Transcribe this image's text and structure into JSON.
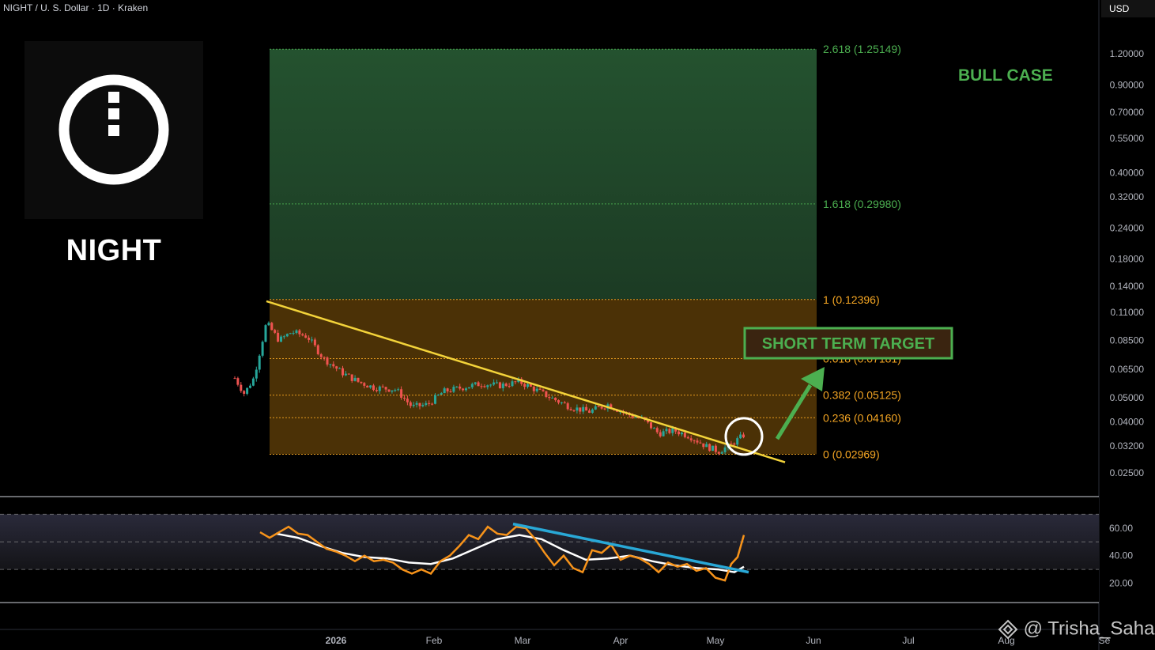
{
  "header": {
    "symbol_line": "NIGHT / U. S. Dollar · 1D · Kraken"
  },
  "logo": {
    "icon": "night-logo-icon",
    "name": "NIGHT"
  },
  "currency": "USD",
  "watermark": "@ Trisha_Saha",
  "colors": {
    "background": "#000000",
    "bull_zone": "#1f4a2c",
    "base_zone": "#5a3a08",
    "fib_green": "#4caf50",
    "fib_orange": "#f5a623",
    "trendline": "#f3d33a",
    "rsi_line": "#f7931a",
    "rsi_ma": "#ffffff",
    "rsi_trend": "#29a8d6",
    "candle_up": "#26a69a",
    "candle_down": "#ef5350"
  },
  "chart_data": {
    "type": "candlestick",
    "scale": "log",
    "y_ticks": [
      1.2,
      0.9,
      0.7,
      0.55,
      0.4,
      0.32,
      0.24,
      0.18,
      0.14,
      0.11,
      0.085,
      0.065,
      0.05,
      0.04,
      0.032,
      0.025
    ],
    "y_tick_labels": [
      "1.20000",
      "0.90000",
      "0.70000",
      "0.55000",
      "0.40000",
      "0.32000",
      "0.24000",
      "0.18000",
      "0.14000",
      "0.11000",
      "0.08500",
      "0.06500",
      "0.05000",
      "0.04000",
      "0.03200",
      "0.02500"
    ],
    "x_ticks": [
      {
        "date": "2026-01-01",
        "label": "2026"
      },
      {
        "date": "2026-02-01",
        "label": "Feb"
      },
      {
        "date": "2026-03-01",
        "label": "Mar"
      },
      {
        "date": "2026-04-01",
        "label": "Apr"
      },
      {
        "date": "2026-05-01",
        "label": "May"
      },
      {
        "date": "2026-06-01",
        "label": "Jun"
      },
      {
        "date": "2026-07-01",
        "label": "Jul"
      },
      {
        "date": "2026-08-01",
        "label": "Aug"
      },
      {
        "date": "2026-09-01",
        "label": "Se"
      }
    ],
    "fib_levels": [
      {
        "ratio": "2.618",
        "value": 1.25149,
        "label": "2.618 (1.25149)",
        "zone": "bull"
      },
      {
        "ratio": "1.618",
        "value": 0.2998,
        "label": "1.618 (0.29980)",
        "zone": "bull"
      },
      {
        "ratio": "1",
        "value": 0.12396,
        "label": "1 (0.12396)",
        "zone": "base"
      },
      {
        "ratio": "0.618",
        "value": 0.07181,
        "label": "0.618 (0.07181)",
        "zone": "base"
      },
      {
        "ratio": "0.382",
        "value": 0.05125,
        "label": "0.382 (0.05125)",
        "zone": "base"
      },
      {
        "ratio": "0.236",
        "value": 0.0416,
        "label": "0.236 (0.04160)",
        "zone": "base"
      },
      {
        "ratio": "0",
        "value": 0.02969,
        "label": "0 (0.02969)",
        "zone": "base"
      }
    ],
    "fib_range": {
      "start": "2025-12-13",
      "end": "2026-06-04"
    },
    "annotations": {
      "bull_case": "BULL CASE",
      "short_term_target": "SHORT TERM TARGET"
    },
    "trendline": [
      {
        "date": "2025-12-12",
        "value": 0.122
      },
      {
        "date": "2026-05-15",
        "value": 0.0302
      }
    ],
    "breakout_circle": {
      "date": "2026-05-11",
      "value": 0.035
    },
    "price_path": [
      {
        "date": "2025-12-02",
        "value": 0.06
      },
      {
        "date": "2025-12-05",
        "value": 0.052
      },
      {
        "date": "2025-12-08",
        "value": 0.06
      },
      {
        "date": "2025-12-12",
        "value": 0.1
      },
      {
        "date": "2025-12-16",
        "value": 0.085
      },
      {
        "date": "2025-12-20",
        "value": 0.092
      },
      {
        "date": "2025-12-25",
        "value": 0.088
      },
      {
        "date": "2025-12-30",
        "value": 0.072
      },
      {
        "date": "2026-01-05",
        "value": 0.063
      },
      {
        "date": "2026-01-10",
        "value": 0.058
      },
      {
        "date": "2026-01-15",
        "value": 0.055
      },
      {
        "date": "2026-01-22",
        "value": 0.054
      },
      {
        "date": "2026-01-27",
        "value": 0.046
      },
      {
        "date": "2026-02-01",
        "value": 0.047
      },
      {
        "date": "2026-02-06",
        "value": 0.053
      },
      {
        "date": "2026-02-12",
        "value": 0.055
      },
      {
        "date": "2026-02-18",
        "value": 0.057
      },
      {
        "date": "2026-02-24",
        "value": 0.056
      },
      {
        "date": "2026-03-02",
        "value": 0.058
      },
      {
        "date": "2026-03-07",
        "value": 0.054
      },
      {
        "date": "2026-03-12",
        "value": 0.05
      },
      {
        "date": "2026-03-18",
        "value": 0.046
      },
      {
        "date": "2026-03-24",
        "value": 0.044
      },
      {
        "date": "2026-03-30",
        "value": 0.047
      },
      {
        "date": "2026-04-05",
        "value": 0.043
      },
      {
        "date": "2026-04-10",
        "value": 0.041
      },
      {
        "date": "2026-04-15",
        "value": 0.036
      },
      {
        "date": "2026-04-20",
        "value": 0.037
      },
      {
        "date": "2026-04-25",
        "value": 0.035
      },
      {
        "date": "2026-04-30",
        "value": 0.032
      },
      {
        "date": "2026-05-04",
        "value": 0.0305
      },
      {
        "date": "2026-05-08",
        "value": 0.0325
      },
      {
        "date": "2026-05-12",
        "value": 0.0355
      }
    ],
    "rsi": {
      "y_ticks": [
        60,
        40,
        20
      ],
      "y_tick_labels": [
        "60.00",
        "40.00",
        "20.00"
      ],
      "bands": [
        70,
        50,
        30
      ],
      "ylim": [
        10,
        80
      ],
      "rsi_values": [
        {
          "date": "2025-12-10",
          "value": 57
        },
        {
          "date": "2025-12-13",
          "value": 53
        },
        {
          "date": "2025-12-16",
          "value": 57
        },
        {
          "date": "2025-12-19",
          "value": 61
        },
        {
          "date": "2025-12-22",
          "value": 56
        },
        {
          "date": "2025-12-25",
          "value": 55
        },
        {
          "date": "2025-12-28",
          "value": 50
        },
        {
          "date": "2025-12-31",
          "value": 45
        },
        {
          "date": "2026-01-03",
          "value": 43
        },
        {
          "date": "2026-01-06",
          "value": 40
        },
        {
          "date": "2026-01-09",
          "value": 36
        },
        {
          "date": "2026-01-12",
          "value": 40
        },
        {
          "date": "2026-01-15",
          "value": 36
        },
        {
          "date": "2026-01-18",
          "value": 37
        },
        {
          "date": "2026-01-21",
          "value": 35
        },
        {
          "date": "2026-01-24",
          "value": 30
        },
        {
          "date": "2026-01-27",
          "value": 27
        },
        {
          "date": "2026-01-30",
          "value": 30
        },
        {
          "date": "2026-02-02",
          "value": 27
        },
        {
          "date": "2026-02-05",
          "value": 36
        },
        {
          "date": "2026-02-08",
          "value": 40
        },
        {
          "date": "2026-02-11",
          "value": 47
        },
        {
          "date": "2026-02-14",
          "value": 55
        },
        {
          "date": "2026-02-17",
          "value": 52
        },
        {
          "date": "2026-02-20",
          "value": 61
        },
        {
          "date": "2026-02-23",
          "value": 56
        },
        {
          "date": "2026-02-26",
          "value": 55
        },
        {
          "date": "2026-03-01",
          "value": 61
        },
        {
          "date": "2026-03-04",
          "value": 60
        },
        {
          "date": "2026-03-07",
          "value": 52
        },
        {
          "date": "2026-03-10",
          "value": 42
        },
        {
          "date": "2026-03-13",
          "value": 33
        },
        {
          "date": "2026-03-16",
          "value": 40
        },
        {
          "date": "2026-03-19",
          "value": 31
        },
        {
          "date": "2026-03-22",
          "value": 28
        },
        {
          "date": "2026-03-25",
          "value": 44
        },
        {
          "date": "2026-03-28",
          "value": 42
        },
        {
          "date": "2026-03-31",
          "value": 48
        },
        {
          "date": "2026-04-03",
          "value": 37
        },
        {
          "date": "2026-04-06",
          "value": 40
        },
        {
          "date": "2026-04-09",
          "value": 38
        },
        {
          "date": "2026-04-12",
          "value": 34
        },
        {
          "date": "2026-04-15",
          "value": 28
        },
        {
          "date": "2026-04-18",
          "value": 35
        },
        {
          "date": "2026-04-21",
          "value": 32
        },
        {
          "date": "2026-04-24",
          "value": 34
        },
        {
          "date": "2026-04-27",
          "value": 29
        },
        {
          "date": "2026-04-30",
          "value": 31
        },
        {
          "date": "2026-05-03",
          "value": 24
        },
        {
          "date": "2026-05-06",
          "value": 22
        },
        {
          "date": "2026-05-08",
          "value": 34
        },
        {
          "date": "2026-05-10",
          "value": 39
        },
        {
          "date": "2026-05-12",
          "value": 55
        }
      ],
      "ma_values": [
        {
          "date": "2025-12-15",
          "value": 56
        },
        {
          "date": "2025-12-22",
          "value": 53
        },
        {
          "date": "2025-12-29",
          "value": 47
        },
        {
          "date": "2026-01-05",
          "value": 42
        },
        {
          "date": "2026-01-12",
          "value": 39
        },
        {
          "date": "2026-01-19",
          "value": 38
        },
        {
          "date": "2026-01-26",
          "value": 35
        },
        {
          "date": "2026-02-02",
          "value": 34
        },
        {
          "date": "2026-02-09",
          "value": 38
        },
        {
          "date": "2026-02-16",
          "value": 45
        },
        {
          "date": "2026-02-23",
          "value": 52
        },
        {
          "date": "2026-03-02",
          "value": 55
        },
        {
          "date": "2026-03-09",
          "value": 52
        },
        {
          "date": "2026-03-16",
          "value": 44
        },
        {
          "date": "2026-03-23",
          "value": 37
        },
        {
          "date": "2026-03-30",
          "value": 38
        },
        {
          "date": "2026-04-06",
          "value": 40
        },
        {
          "date": "2026-04-13",
          "value": 36
        },
        {
          "date": "2026-04-20",
          "value": 33
        },
        {
          "date": "2026-04-27",
          "value": 31
        },
        {
          "date": "2026-05-04",
          "value": 30
        },
        {
          "date": "2026-05-09",
          "value": 28
        },
        {
          "date": "2026-05-12",
          "value": 32
        }
      ],
      "trendline": [
        {
          "date": "2026-02-28",
          "value": 63
        },
        {
          "date": "2026-05-12",
          "value": 28
        }
      ]
    }
  }
}
